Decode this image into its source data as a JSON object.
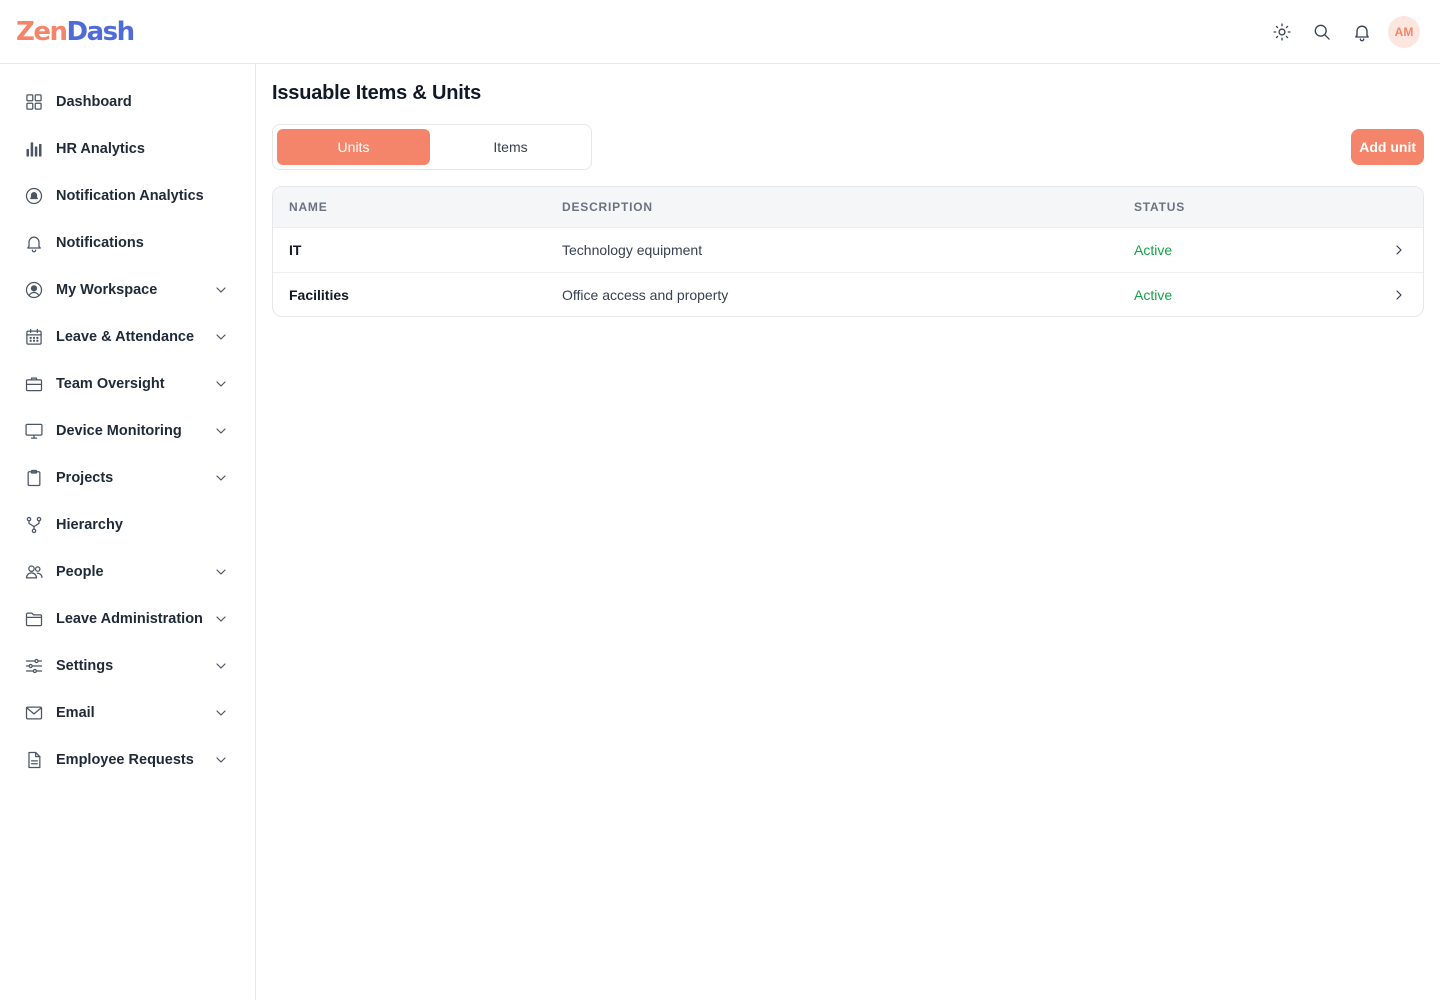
{
  "brand": {
    "part1": "Zen",
    "part2": "Dash"
  },
  "header": {
    "avatar_initials": "AM",
    "icons": [
      "sun-icon",
      "search-icon",
      "bell-icon"
    ]
  },
  "sidebar": {
    "items": [
      {
        "label": "Dashboard",
        "icon": "grid-icon",
        "expandable": false
      },
      {
        "label": "HR Analytics",
        "icon": "bar-chart-icon",
        "expandable": false
      },
      {
        "label": "Notification Analytics",
        "icon": "notification-analytics-icon",
        "expandable": false
      },
      {
        "label": "Notifications",
        "icon": "bell-icon",
        "expandable": false
      },
      {
        "label": "My Workspace",
        "icon": "user-circle-icon",
        "expandable": true
      },
      {
        "label": "Leave & Attendance",
        "icon": "calendar-icon",
        "expandable": true
      },
      {
        "label": "Team Oversight",
        "icon": "briefcase-icon",
        "expandable": true
      },
      {
        "label": "Device Monitoring",
        "icon": "monitor-icon",
        "expandable": true
      },
      {
        "label": "Projects",
        "icon": "clipboard-icon",
        "expandable": true
      },
      {
        "label": "Hierarchy",
        "icon": "hierarchy-icon",
        "expandable": false
      },
      {
        "label": "People",
        "icon": "users-icon",
        "expandable": true
      },
      {
        "label": "Leave Administration",
        "icon": "folder-icon",
        "expandable": true
      },
      {
        "label": "Settings",
        "icon": "sliders-icon",
        "expandable": true
      },
      {
        "label": "Email",
        "icon": "mail-icon",
        "expandable": true
      },
      {
        "label": "Employee Requests",
        "icon": "document-icon",
        "expandable": true
      }
    ]
  },
  "main": {
    "title": "Issuable Items & Units",
    "tabs": [
      {
        "label": "Units",
        "active": true
      },
      {
        "label": "Items",
        "active": false
      }
    ],
    "add_button": "Add unit",
    "table": {
      "columns": [
        "NAME",
        "DESCRIPTION",
        "STATUS"
      ],
      "rows": [
        {
          "name": "IT",
          "description": "Technology equipment",
          "status": "Active"
        },
        {
          "name": "Facilities",
          "description": "Office access and property",
          "status": "Active"
        }
      ]
    }
  },
  "colors": {
    "accent": "#f4856a",
    "brand_blue": "#4f6bd8",
    "status_active": "#16a34a",
    "avatar_bg": "#fde6df"
  }
}
